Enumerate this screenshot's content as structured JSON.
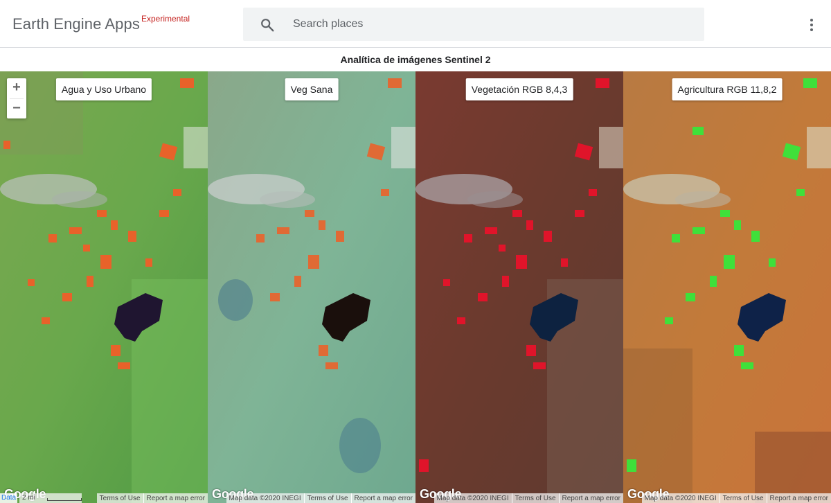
{
  "header": {
    "brand": "Earth Engine Apps",
    "brand_tag": "Experimental",
    "search_placeholder": "Search places",
    "search_value": ""
  },
  "title": "Analítica de imágenes Sentinel 2",
  "zoom": {
    "in_label": "+",
    "out_label": "−"
  },
  "panels": [
    {
      "label": "Agua y Uso Urbano",
      "palette": "agua-urbano"
    },
    {
      "label": "Veg Sana",
      "palette": "veg-sana"
    },
    {
      "label": "Vegetación RGB 8,4,3",
      "palette": "rgb-843"
    },
    {
      "label": "Agricultura RGB 11,8,2",
      "palette": "rgb-1182"
    }
  ],
  "footer": {
    "google": "Google",
    "data_tab": "Data",
    "scale_text": "2 mi",
    "map_data": "Map data ©2020 INEGI",
    "terms": "Terms of Use",
    "report": "Report a map error"
  },
  "colors": {
    "panel1": {
      "base": "#6aa64a",
      "fields": "#e8622a",
      "town": "#b8c0b8",
      "lake": "#1f1530"
    },
    "panel2": {
      "base": "#7fb08f",
      "fields": "#e06a35",
      "town": "#c4ccc8",
      "lake": "#1a0f0c"
    },
    "panel3": {
      "base": "#6a3a2c",
      "fields": "#e0142a",
      "town": "#a89ea0",
      "lake": "#0d2240"
    },
    "panel4": {
      "base": "#c27a3a",
      "fields": "#3fe03a",
      "town": "#c8c0a8",
      "lake": "#0e2248"
    }
  }
}
